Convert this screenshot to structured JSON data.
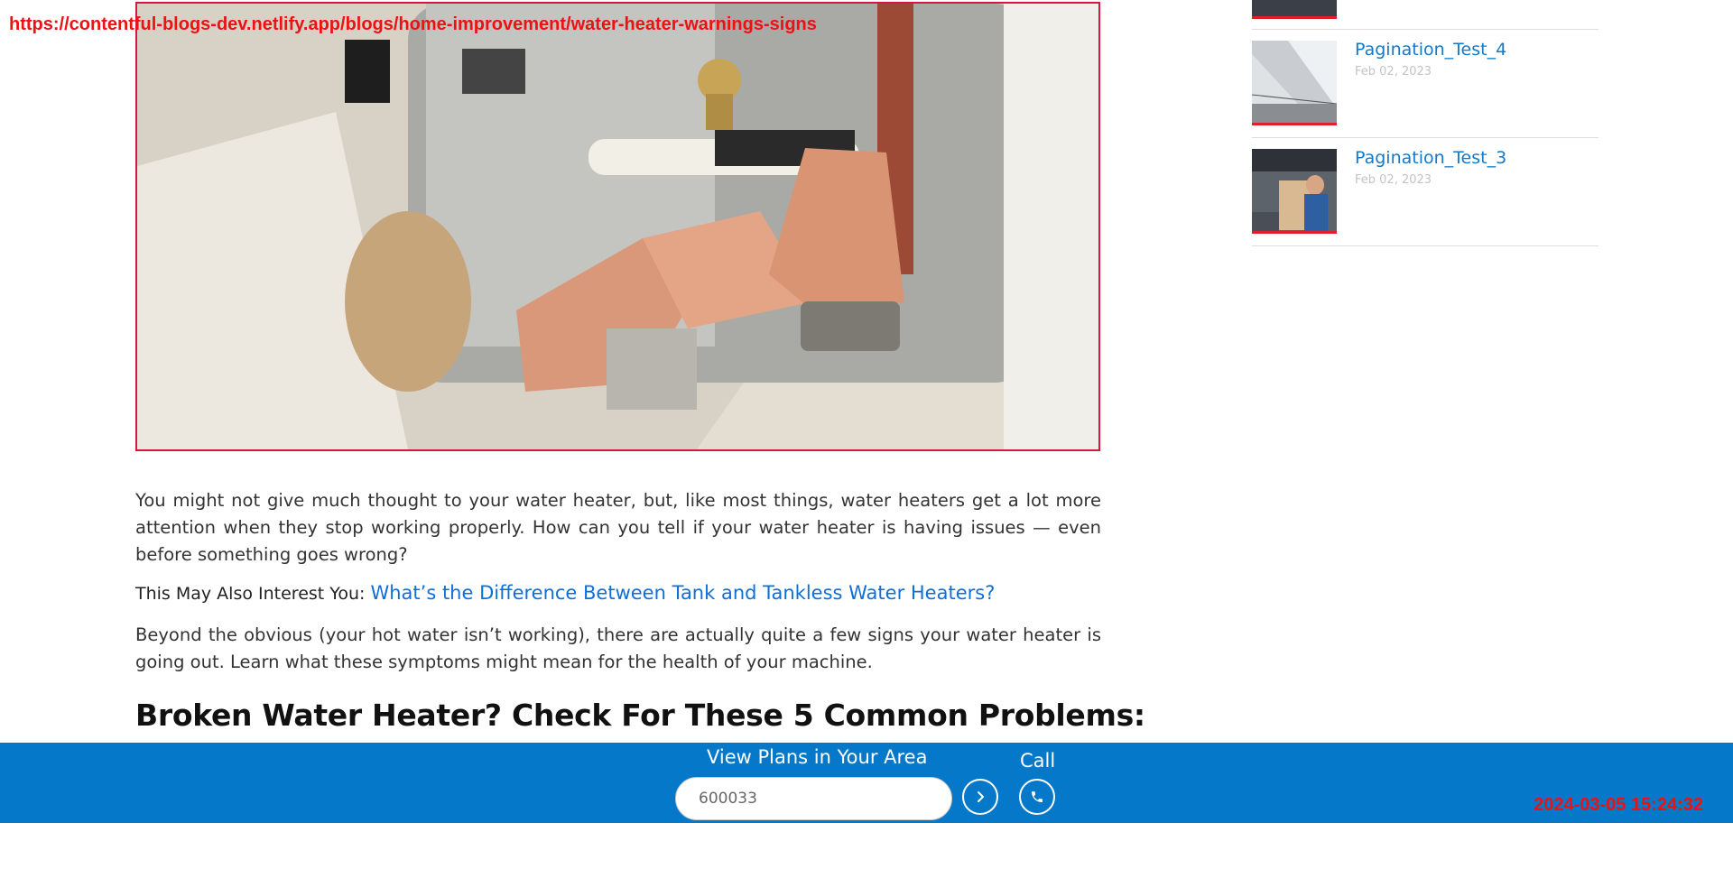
{
  "overlay": {
    "url": "https://contentful-blogs-dev.netlify.app/blogs/home-improvement/water-heater-warnings-signs",
    "timestamp": "2024-03-05 15:24:32"
  },
  "article": {
    "paragraph1": "You might not give much thought to your water heater, but, like most things, water heaters get a lot more attention when they stop working properly. How can you tell if your water heater is having issues — even before something goes wrong?",
    "interest_label": "This May Also Interest You:",
    "interest_link": "What’s the Difference Between Tank and Tankless Water Heaters?",
    "paragraph2": "Beyond the obvious (your hot water isn’t working), there are actually quite a few signs your water heater is going out. Learn what these symptoms might mean for the health of your machine.",
    "heading": "Broken Water Heater? Check For These 5 Common Problems:"
  },
  "sidebar": {
    "items": [
      {
        "title": "Pagination_Test_4",
        "date": "Feb 02, 2023"
      },
      {
        "title": "Pagination_Test_3",
        "date": "Feb 02, 2023"
      }
    ]
  },
  "bottom_bar": {
    "plans_label": "View Plans in Your Area",
    "zip_value": "600033",
    "call_label": "Call"
  },
  "colors": {
    "accent_blue": "#0578c9",
    "link_blue": "#1479c9",
    "thumb_border_red": "#e21e2a",
    "stamp_red": "#ee1111"
  },
  "icons": {
    "go": "chevron-right-icon",
    "call": "phone-icon"
  }
}
